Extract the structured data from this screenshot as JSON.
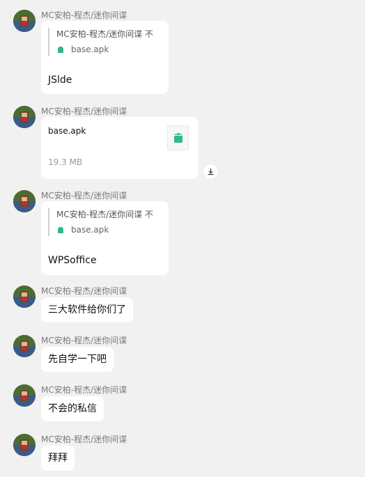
{
  "colors": {
    "background": "#f1f1f1",
    "bubble": "#ffffff",
    "apk_green": "#2fb98a",
    "sender_gray": "#7a7a7a"
  },
  "messages": [
    {
      "sender": "MC安柏-程杰/迷你间谍",
      "type": "reply",
      "quote_name": "MC安柏-程杰/迷你间谍 不",
      "quote_file": "base.apk",
      "text": "JSlde"
    },
    {
      "sender": "MC安柏-程杰/迷你间谍",
      "type": "file",
      "file_name": "base.apk",
      "file_size": "19.3 MB",
      "icon": "android-apk-icon",
      "download_icon": "download-icon"
    },
    {
      "sender": "MC安柏-程杰/迷你间谍",
      "type": "reply",
      "quote_name": "MC安柏-程杰/迷你间谍 不",
      "quote_file": "base.apk",
      "text": "WPSoffice"
    },
    {
      "sender": "MC安柏-程杰/迷你间谍",
      "type": "text",
      "text": "三大软件给你们了"
    },
    {
      "sender": "MC安柏-程杰/迷你间谍",
      "type": "text",
      "text": "先自学一下吧"
    },
    {
      "sender": "MC安柏-程杰/迷你间谍",
      "type": "text",
      "text": "不会的私信"
    },
    {
      "sender": "MC安柏-程杰/迷你间谍",
      "type": "text",
      "text": "拜拜"
    }
  ]
}
